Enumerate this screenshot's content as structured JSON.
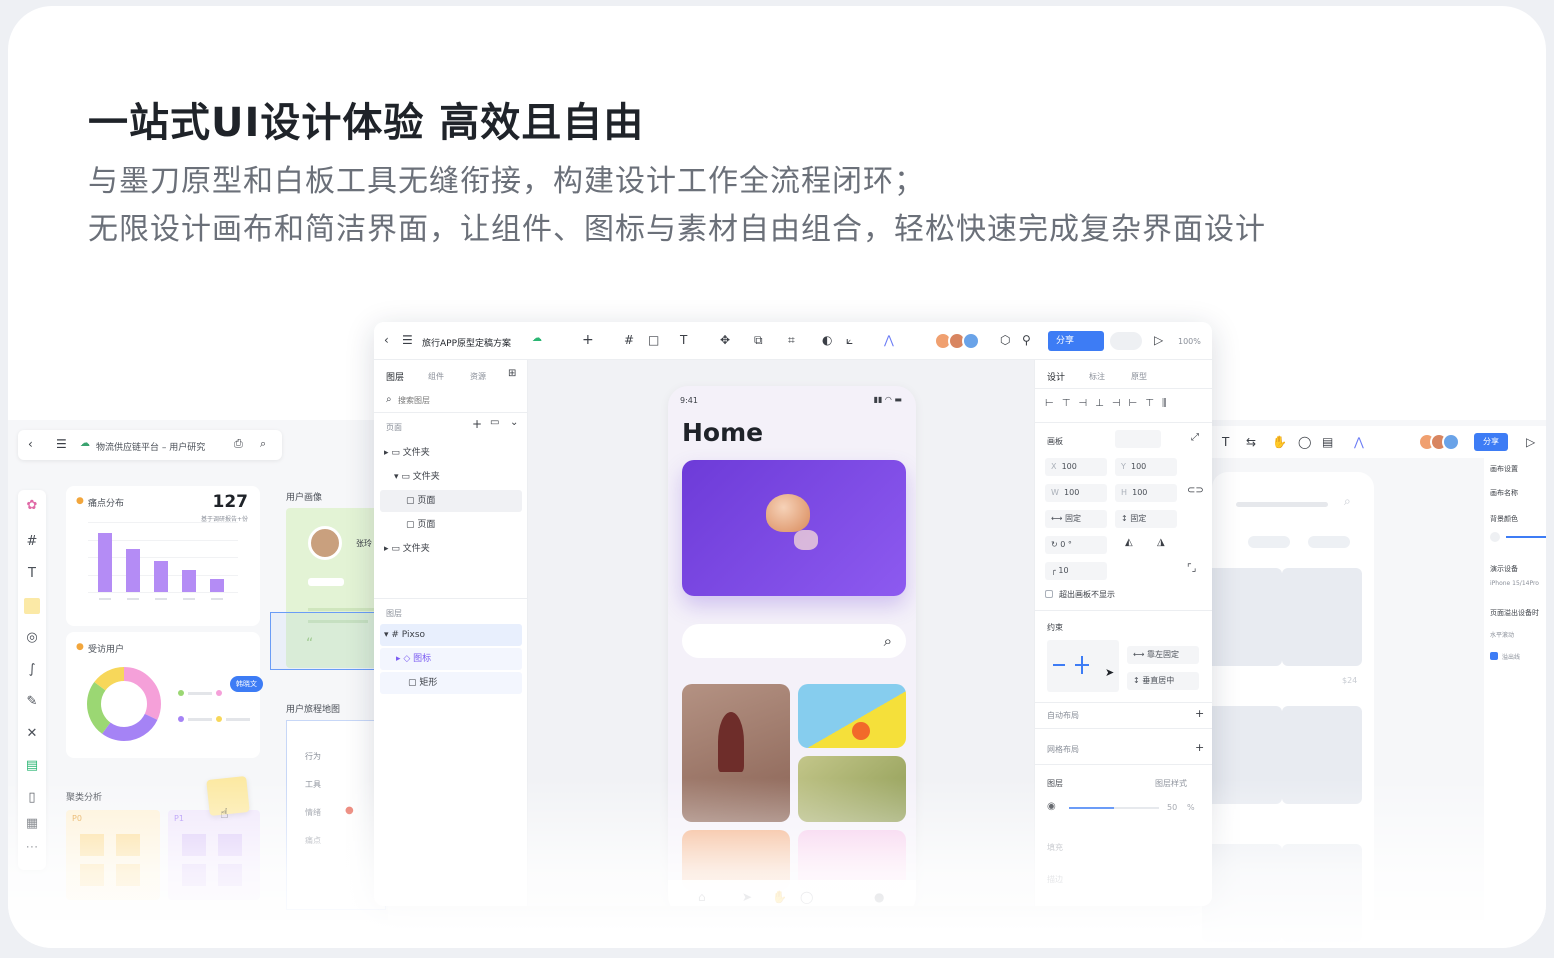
{
  "hero": {
    "title": "一站式UI设计体验 高效且自由",
    "line1": "与墨刀原型和白板工具无缝衔接，构建设计工作全流程闭环；",
    "line2": "无限设计画布和简洁界面，让组件、图标与素材自由组合，轻松快速完成复杂界面设计"
  },
  "board": {
    "title": "物流供应链平台 – 用户研究",
    "pain_title": "痛点分布",
    "pain_count": "127",
    "pain_sub": "基于调研报告+份",
    "persona_title": "用户画像",
    "persona_name": "张玲",
    "visit_title": "受访用户",
    "tag": "韩晓文",
    "journey_title": "用户旅程地图",
    "journey_rows": [
      "行为",
      "工具",
      "情绪",
      "痛点"
    ],
    "cluster_title": "聚类分析",
    "cluster_tags": [
      "P0",
      "P1"
    ],
    "bar_values": [
      0.85,
      0.62,
      0.45,
      0.32,
      0.18
    ],
    "donut": [
      {
        "value": 0.32,
        "color": "#f5a0d9"
      },
      {
        "value": 0.28,
        "color": "#a583f5"
      },
      {
        "value": 0.25,
        "color": "#9bd773"
      },
      {
        "value": 0.15,
        "color": "#f7d75a"
      }
    ]
  },
  "editor": {
    "file_title": "旅行APP原型定稿方案",
    "share": "分享",
    "zoom": "100%",
    "left_tabs": [
      "图层",
      "组件",
      "资源"
    ],
    "search_placeholder": "搜索图层",
    "pages_label": "页面",
    "pages": [
      "文件夹",
      "文件夹",
      "页面",
      "页面",
      "文件夹"
    ],
    "layers_label": "图层",
    "layers": [
      "Pixso",
      "图标",
      "矩形"
    ],
    "phone": {
      "time": "9:41",
      "title": "Home"
    },
    "right_tabs": [
      "设计",
      "标注",
      "原型"
    ],
    "board_label": "画板",
    "x_label": "X",
    "x": "100",
    "y_label": "Y",
    "y": "100",
    "w_label": "W",
    "w": "100",
    "h_label": "H",
    "h": "100",
    "fix1": "固定",
    "fix2": "固定",
    "rotate": "0 °",
    "radius": "10",
    "clip": "超出画板不显示",
    "constraint_label": "约束",
    "constraint_h": "靠左固定",
    "constraint_v": "垂直居中",
    "auto_layout": "自动布局",
    "grid_layout": "网格布局",
    "layer_section": "图层",
    "layer_style": "图层样式",
    "opacity": "50",
    "opacity_unit": "%",
    "fill": "填充",
    "stroke": "描边"
  },
  "right_board": {
    "share": "分享",
    "side": [
      "画布设置",
      "画布名称",
      "背景颜色",
      "演示设备",
      "iPhone 15/14Pro",
      "页面溢出设备时",
      "水平滚动",
      "溢出线"
    ],
    "price": "$24"
  }
}
